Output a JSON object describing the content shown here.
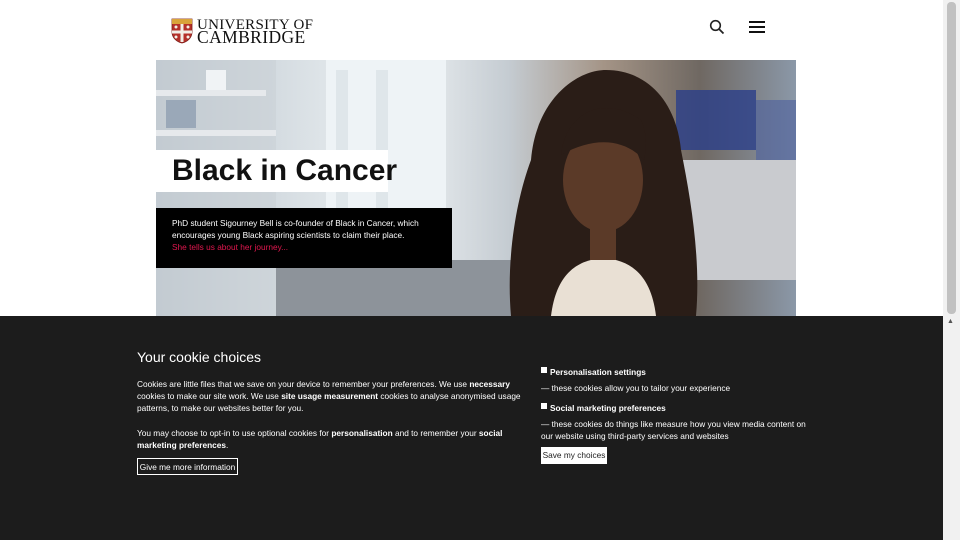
{
  "header": {
    "logo_line1": "UNIVERSITY OF",
    "logo_line2": "CAMBRIDGE",
    "search_icon": "search-icon",
    "menu_icon": "hamburger-menu-icon"
  },
  "hero": {
    "title": "Black in Cancer",
    "description": "PhD student Sigourney Bell is co-founder of Black in Cancer, which encourages young Black aspiring scientists to claim their place.",
    "link_text": "She tells us about her journey...",
    "link_color": "#e2174f"
  },
  "cookie": {
    "heading": "Your cookie choices",
    "p1": [
      "Cookies are little files that we save on your device to remember your preferences. We use ",
      "necessary",
      " cookies to make our site work. We use ",
      "site usage measurement",
      " cookies to analyse anonymised usage patterns, to make our websites better for you."
    ],
    "p2": [
      "You may choose to opt-in to use optional cookies for ",
      "personalisation",
      " and to remember your ",
      "social marketing preferences",
      "."
    ],
    "more_button": "Give me more information",
    "options": [
      {
        "label": "Personalisation settings",
        "desc": "— these cookies allow you to tailor your experience",
        "checked": false
      },
      {
        "label": "Social marketing preferences",
        "desc": "— these cookies do things like measure how you view media content on our website using third-party services and websites",
        "checked": false
      }
    ],
    "save_button": "Save my choices",
    "background": "#1c1c1c"
  }
}
